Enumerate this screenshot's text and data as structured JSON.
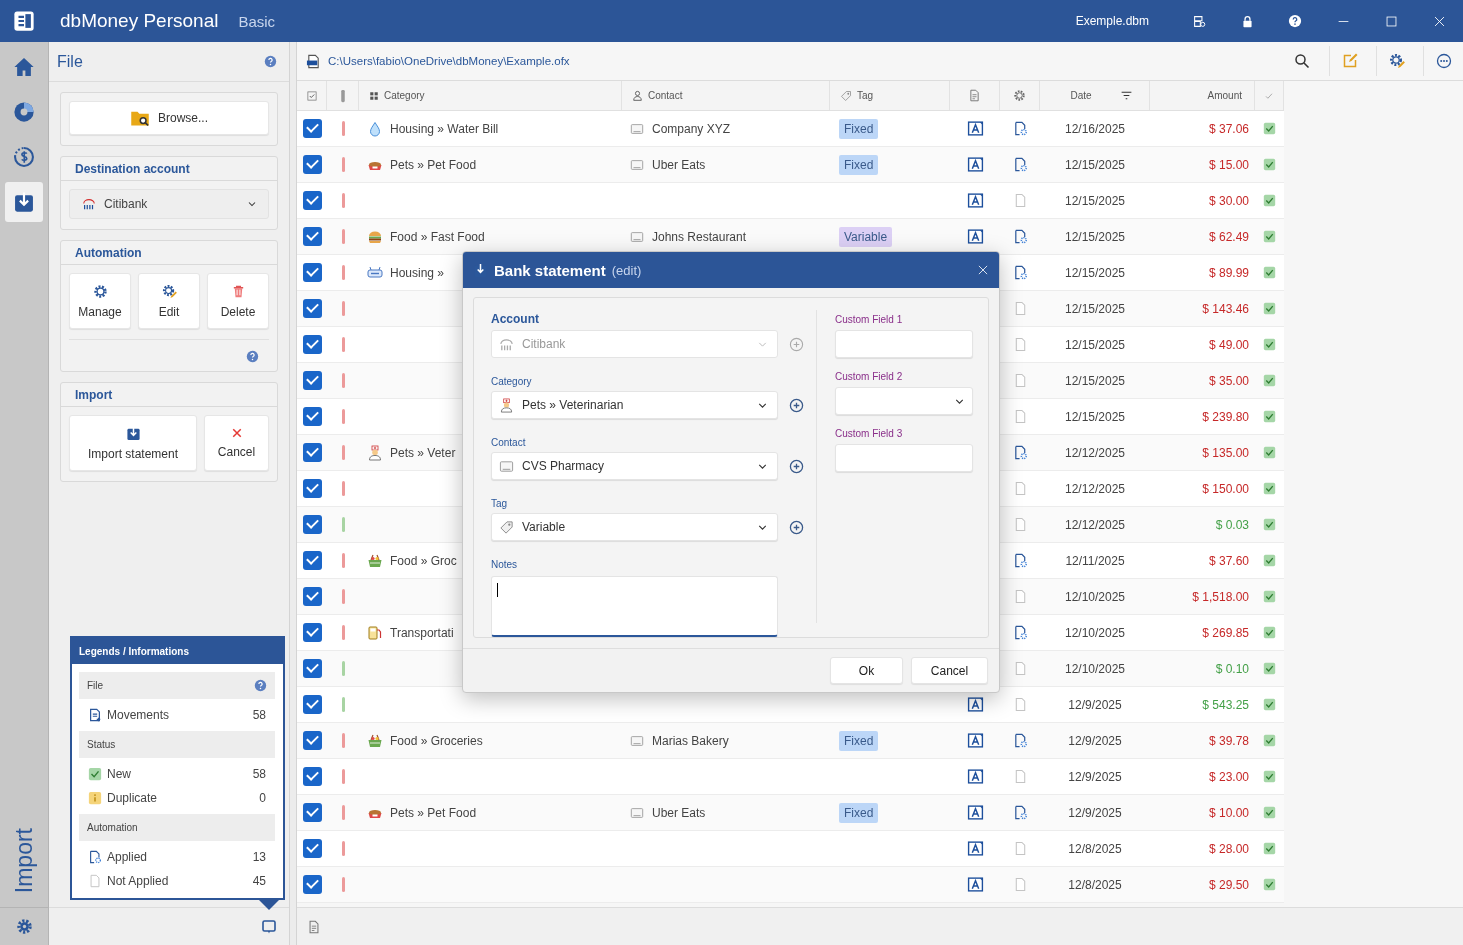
{
  "app": {
    "title": "dbMoney Personal",
    "edition": "Basic",
    "file": "Exemple.dbm"
  },
  "nav": {
    "items": [
      {
        "kind": "home",
        "selected": false
      },
      {
        "kind": "reports",
        "selected": false
      },
      {
        "kind": "scheduled",
        "selected": false
      },
      {
        "kind": "import",
        "selected": true
      }
    ],
    "section_label": "Import"
  },
  "left_panel": {
    "title": "File",
    "browse_button": "Browse...",
    "destination": {
      "heading": "Destination account",
      "account": "Citibank"
    },
    "automation": {
      "heading": "Automation",
      "buttons": [
        {
          "kind": "manage",
          "label": "Manage"
        },
        {
          "kind": "edit",
          "label": "Edit"
        },
        {
          "kind": "delete",
          "label": "Delete"
        }
      ]
    },
    "import": {
      "heading": "Import",
      "buttons": [
        {
          "kind": "import",
          "label": "Import statement"
        },
        {
          "kind": "cancel",
          "label": "Cancel"
        }
      ]
    }
  },
  "legend": {
    "title": "Legends / Informations",
    "sections": [
      {
        "heading": "File",
        "help": true,
        "items": [
          {
            "kind": "movements",
            "label": "Movements",
            "count": "58"
          }
        ]
      },
      {
        "heading": "Status",
        "help": false,
        "items": [
          {
            "kind": "new",
            "label": "New",
            "count": "58"
          },
          {
            "kind": "duplicate",
            "label": "Duplicate",
            "count": "0"
          }
        ]
      },
      {
        "heading": "Automation",
        "help": false,
        "items": [
          {
            "kind": "applied",
            "label": "Applied",
            "count": "13"
          },
          {
            "kind": "not_applied",
            "label": "Not Applied",
            "count": "45"
          }
        ]
      }
    ]
  },
  "file_path": "C:\\Users\\fabio\\OneDrive\\dbMoney\\Example.ofx",
  "table": {
    "columns": [
      {
        "kind": "select"
      },
      {
        "kind": "bar"
      },
      {
        "kind": "category",
        "label": "Category"
      },
      {
        "kind": "contact",
        "label": "Contact"
      },
      {
        "kind": "tag",
        "label": "Tag"
      },
      {
        "kind": "note"
      },
      {
        "kind": "automation"
      },
      {
        "kind": "date",
        "label": "Date"
      },
      {
        "kind": "amount",
        "label": "Amount"
      },
      {
        "kind": "status"
      }
    ],
    "rows": [
      {
        "checked": true,
        "color": "#ec9a9a",
        "category": {
          "kind": "water",
          "text": "Housing » Water Bill"
        },
        "contact": "Company XYZ",
        "tag": {
          "text": "Fixed",
          "color": "#bcd6f7"
        },
        "note": true,
        "applied": true,
        "date": "12/16/2025",
        "amount": "$ 37.06",
        "income": false,
        "new": true
      },
      {
        "checked": true,
        "color": "#ec9a9a",
        "category": {
          "kind": "bowl",
          "text": "Pets » Pet Food"
        },
        "contact": "Uber Eats",
        "tag": {
          "text": "Fixed",
          "color": "#bcd6f7"
        },
        "note": true,
        "applied": true,
        "date": "12/15/2025",
        "amount": "$ 15.00",
        "income": false,
        "new": true
      },
      {
        "checked": true,
        "color": "#ec9a9a",
        "note": true,
        "applied": false,
        "date": "12/15/2025",
        "amount": "$ 30.00",
        "income": false,
        "new": true
      },
      {
        "checked": true,
        "color": "#ec9a9a",
        "category": {
          "kind": "burger",
          "text": "Food » Fast Food"
        },
        "contact": "Johns Restaurant",
        "tag": {
          "text": "Variable",
          "color": "#dcd0f5"
        },
        "note": true,
        "applied": true,
        "date": "12/15/2025",
        "amount": "$ 62.49",
        "income": false,
        "new": true
      },
      {
        "checked": true,
        "color": "#ec9a9a",
        "category": {
          "kind": "router",
          "text": "Housing »"
        },
        "applied": true,
        "date": "12/15/2025",
        "amount": "$ 89.99",
        "income": false,
        "new": true
      },
      {
        "checked": true,
        "color": "#ec9a9a",
        "applied": false,
        "date": "12/15/2025",
        "amount": "$ 143.46",
        "income": false,
        "new": true
      },
      {
        "checked": true,
        "color": "#ec9a9a",
        "applied": false,
        "date": "12/15/2025",
        "amount": "$ 49.00",
        "income": false,
        "new": true
      },
      {
        "checked": true,
        "color": "#ec9a9a",
        "applied": false,
        "date": "12/15/2025",
        "amount": "$ 35.00",
        "income": false,
        "new": true
      },
      {
        "checked": true,
        "color": "#ec9a9a",
        "applied": false,
        "date": "12/15/2025",
        "amount": "$ 239.80",
        "income": false,
        "new": true
      },
      {
        "checked": true,
        "color": "#ec9a9a",
        "category": {
          "kind": "nurse",
          "text": "Pets » Veter"
        },
        "applied": true,
        "date": "12/12/2025",
        "amount": "$ 135.00",
        "income": false,
        "new": true
      },
      {
        "checked": true,
        "color": "#ec9a9a",
        "applied": false,
        "date": "12/12/2025",
        "amount": "$ 150.00",
        "income": false,
        "new": true
      },
      {
        "checked": true,
        "color": "#a8d4a3",
        "applied": false,
        "date": "12/12/2025",
        "amount": "$ 0.03",
        "income": true,
        "new": true
      },
      {
        "checked": true,
        "color": "#ec9a9a",
        "category": {
          "kind": "basket",
          "text": "Food » Groc"
        },
        "applied": true,
        "date": "12/11/2025",
        "amount": "$ 37.60",
        "income": false,
        "new": true
      },
      {
        "checked": true,
        "color": "#ec9a9a",
        "applied": false,
        "date": "12/10/2025",
        "amount": "$ 1,518.00",
        "income": false,
        "new": true
      },
      {
        "checked": true,
        "color": "#ec9a9a",
        "category": {
          "kind": "fuel",
          "text": "Transportati"
        },
        "applied": true,
        "date": "12/10/2025",
        "amount": "$ 269.85",
        "income": false,
        "new": true
      },
      {
        "checked": true,
        "color": "#a8d4a3",
        "applied": false,
        "date": "12/10/2025",
        "amount": "$ 0.10",
        "income": true,
        "new": true
      },
      {
        "checked": true,
        "color": "#a8d4a3",
        "note": true,
        "applied": false,
        "date": "12/9/2025",
        "amount": "$ 543.25",
        "income": true,
        "new": true
      },
      {
        "checked": true,
        "color": "#ec9a9a",
        "category": {
          "kind": "basket",
          "text": "Food » Groceries"
        },
        "contact": "Marias Bakery",
        "tag": {
          "text": "Fixed",
          "color": "#bcd6f7"
        },
        "note": true,
        "applied": true,
        "date": "12/9/2025",
        "amount": "$ 39.78",
        "income": false,
        "new": true
      },
      {
        "checked": true,
        "color": "#ec9a9a",
        "note": true,
        "applied": false,
        "date": "12/9/2025",
        "amount": "$ 23.00",
        "income": false,
        "new": true
      },
      {
        "checked": true,
        "color": "#ec9a9a",
        "category": {
          "kind": "bowl",
          "text": "Pets » Pet Food"
        },
        "contact": "Uber Eats",
        "tag": {
          "text": "Fixed",
          "color": "#bcd6f7"
        },
        "note": true,
        "applied": true,
        "date": "12/9/2025",
        "amount": "$ 10.00",
        "income": false,
        "new": true
      },
      {
        "checked": true,
        "color": "#ec9a9a",
        "note": true,
        "applied": false,
        "date": "12/8/2025",
        "amount": "$ 28.00",
        "income": false,
        "new": true
      },
      {
        "checked": true,
        "color": "#ec9a9a",
        "note": true,
        "applied": false,
        "date": "12/8/2025",
        "amount": "$ 29.50",
        "income": false,
        "new": true
      }
    ]
  },
  "dialog": {
    "title": "Bank statement",
    "subtitle": "(edit)",
    "fields": [
      {
        "kind": "account",
        "label": "Account",
        "value": "Citibank",
        "disabled": true
      },
      {
        "kind": "category",
        "label": "Category",
        "value": "Pets » Veterinarian",
        "disabled": false
      },
      {
        "kind": "contact",
        "label": "Contact",
        "value": "CVS Pharmacy",
        "disabled": false
      },
      {
        "kind": "tag",
        "label": "Tag",
        "value": "Variable",
        "disabled": false
      },
      {
        "kind": "notes",
        "label": "Notes",
        "focused": true
      }
    ],
    "custom_fields": [
      {
        "kind": "text",
        "label": "Custom Field 1"
      },
      {
        "kind": "combo",
        "label": "Custom Field 2"
      },
      {
        "kind": "text",
        "label": "Custom Field 3"
      }
    ],
    "buttons": [
      {
        "label": "Ok"
      },
      {
        "label": "Cancel"
      }
    ]
  }
}
